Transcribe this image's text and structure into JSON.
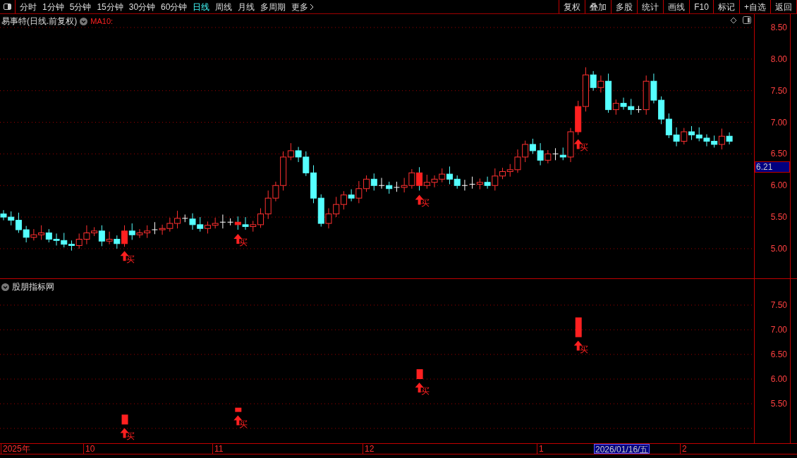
{
  "toolbar": {
    "tabs": [
      {
        "label": "分时",
        "selected": false
      },
      {
        "label": "1分钟",
        "selected": false
      },
      {
        "label": "5分钟",
        "selected": false
      },
      {
        "label": "15分钟",
        "selected": false
      },
      {
        "label": "30分钟",
        "selected": false
      },
      {
        "label": "60分钟",
        "selected": false
      },
      {
        "label": "日线",
        "selected": true
      },
      {
        "label": "周线",
        "selected": false
      },
      {
        "label": "月线",
        "selected": false
      },
      {
        "label": "多周期",
        "selected": false
      }
    ],
    "more": "更多",
    "buttons": [
      "复权",
      "叠加",
      "多股",
      "统计",
      "画线",
      "F10",
      "标记",
      "+自选",
      "返回"
    ]
  },
  "main_panel": {
    "title": "易事特(日线.前复权)",
    "indicator": "MA10:",
    "y_ticks": [
      "8.50",
      "8.00",
      "7.50",
      "7.00",
      "6.50",
      "6.00",
      "5.50",
      "5.00"
    ],
    "price_tag": "6.21",
    "signals": [
      {
        "label": "买"
      },
      {
        "label": "买"
      },
      {
        "label": "买"
      },
      {
        "label": "买"
      }
    ]
  },
  "sub_panel": {
    "title": "股朋指标网",
    "y_ticks": [
      "7.50",
      "7.00",
      "6.50",
      "6.00",
      "5.50"
    ],
    "signals": [
      {
        "label": "买"
      },
      {
        "label": "买"
      },
      {
        "label": "买"
      },
      {
        "label": "买"
      }
    ]
  },
  "time_axis": [
    {
      "label": "2025年",
      "selected": false
    },
    {
      "label": "10",
      "selected": false
    },
    {
      "label": "11",
      "selected": false
    },
    {
      "label": "12",
      "selected": false
    },
    {
      "label": "1",
      "selected": false
    },
    {
      "label": "2026/01/16/五",
      "selected": true
    },
    {
      "label": "2",
      "selected": false
    }
  ]
}
